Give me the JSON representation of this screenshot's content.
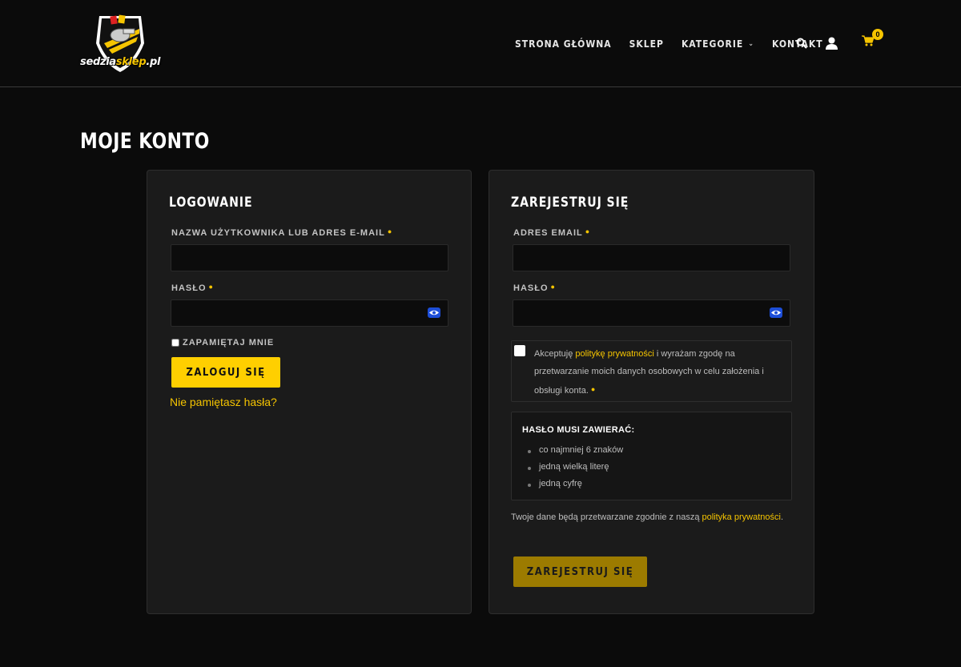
{
  "brand": {
    "logo_part1": "sedzia",
    "logo_part2": "sklep",
    "logo_part3": ".pl"
  },
  "nav": {
    "items": [
      {
        "label": "STRONA GŁÓWNA"
      },
      {
        "label": "SKLEP"
      },
      {
        "label": "KATEGORIE"
      },
      {
        "label": "KONTAKT"
      }
    ],
    "cart_count": "0"
  },
  "page": {
    "title": "MOJE KONTO"
  },
  "login": {
    "title": "LOGOWANIE",
    "username_label": "NAZWA UŻYTKOWNIKA LUB ADRES E-MAIL",
    "username_value": "",
    "password_label": "HASŁO",
    "password_value": "",
    "remember_label": "ZAPAMIĘTAJ MNIE",
    "submit_label": "ZALOGUJ SIĘ",
    "forgot_label": "Nie pamiętasz hasła?"
  },
  "register": {
    "title": "ZAREJESTRUJ SIĘ",
    "email_label": "ADRES EMAIL",
    "email_value": "",
    "password_label": "HASŁO",
    "password_value": "",
    "consent_prefix": "Akceptuję ",
    "consent_link": "politykę prywatności",
    "consent_suffix": " i wyrażam zgodę na przetwarzanie moich danych osobowych w celu założenia i obsługi konta.",
    "pw_rules_title": "HASŁO MUSI ZAWIERAĆ:",
    "pw_rules": [
      "co najmniej 6 znaków",
      "jedną wielką literę",
      "jedną cyfrę"
    ],
    "privacy_prefix": "Twoje dane będą przetwarzane zgodnie z naszą ",
    "privacy_link": "polityka prywatności",
    "privacy_suffix": ".",
    "submit_label": "ZAREJESTRUJ SIĘ"
  },
  "colors": {
    "accent": "#f5c400",
    "background": "#0b0b0b",
    "panel": "#1b1b1b"
  }
}
